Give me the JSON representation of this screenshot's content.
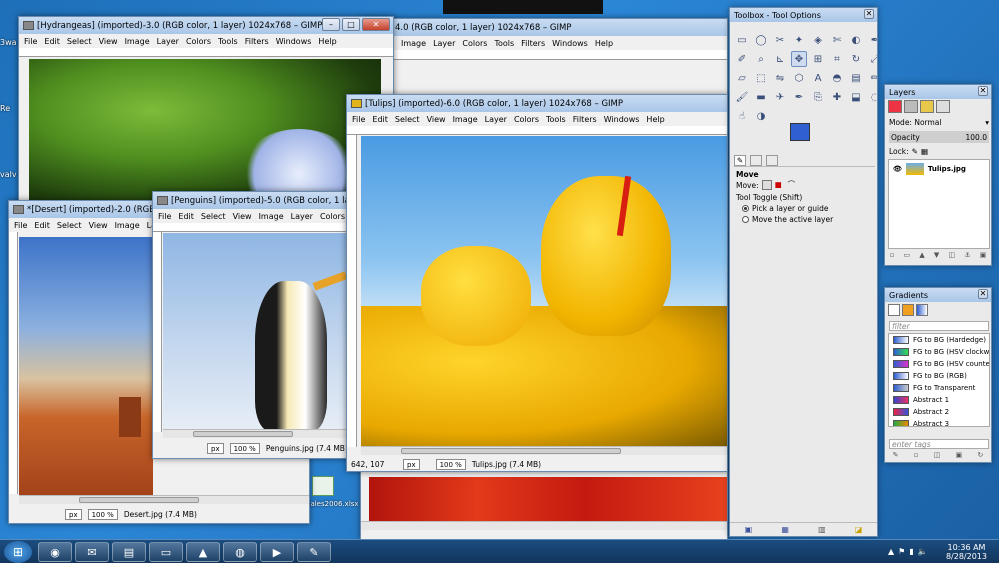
{
  "desktop": {
    "items": [
      {
        "label": "3wa"
      },
      {
        "label": "Re"
      },
      {
        "label": "valv"
      }
    ],
    "file_label": "Sales2006.xlsx"
  },
  "colors": {
    "accent": "#3b6fd6",
    "titlebar": "#b9d1ee",
    "taskbar": "#163f6b"
  },
  "windows": {
    "back": {
      "title": "4.0 (RGB color, 1 layer) 1024x768 – GIMP",
      "menu": [
        "Image",
        "Layer",
        "Colors",
        "Tools",
        "Filters",
        "Windows",
        "Help"
      ]
    },
    "hydrangeas": {
      "title": "[Hydrangeas] (imported)-3.0 (RGB color, 1 layer) 1024x768 – GIMP",
      "menu": [
        "File",
        "Edit",
        "Select",
        "View",
        "Image",
        "Layer",
        "Colors",
        "Tools",
        "Filters",
        "Windows",
        "Help"
      ]
    },
    "desert": {
      "title": "*[Desert] (imported)-2.0 (RGB color",
      "menu": [
        "File",
        "Edit",
        "Select",
        "View",
        "Image",
        "Laye"
      ],
      "unit": "px",
      "zoom": "100 %",
      "status": "Desert.jpg (7.4 MB)"
    },
    "penguins": {
      "title": "[Penguins] (imported)-5.0 (RGB color, 1 layer) 1024x768",
      "menu": [
        "File",
        "Edit",
        "Select",
        "View",
        "Image",
        "Layer",
        "Colors",
        "To"
      ],
      "unit": "px",
      "zoom": "100 %",
      "status": "Penguins.jpg (7.4 MB)"
    },
    "tulips": {
      "title": "[Tulips] (imported)-6.0 (RGB color, 1 layer) 1024x768 – GIMP",
      "menu": [
        "File",
        "Edit",
        "Select",
        "View",
        "Image",
        "Layer",
        "Colors",
        "Tools",
        "Filters",
        "Windows",
        "Help"
      ],
      "coords": "642, 107",
      "unit": "px",
      "zoom": "100 %",
      "status": "Tulips.jpg (7.4 MB)"
    }
  },
  "toolbox": {
    "title": "Toolbox - Tool Options",
    "tools": [
      "rect-select",
      "ellipse-select",
      "free-select",
      "fuzzy-select",
      "color-select",
      "scissors",
      "foreground-select",
      "paths",
      "color-picker",
      "zoom",
      "measure",
      "move",
      "align",
      "crop",
      "rotate",
      "scale",
      "shear",
      "perspective",
      "flip",
      "cage",
      "text",
      "bucket-fill",
      "blend",
      "pencil",
      "paintbrush",
      "eraser",
      "airbrush",
      "ink",
      "clone",
      "heal",
      "perspective-clone",
      "blur",
      "smudge",
      "dodge-burn"
    ],
    "active_tool": "move",
    "option_title": "Move",
    "move_label": "Move:",
    "toggle_label": "Tool Toggle  (Shift)",
    "options": [
      "Pick a layer or guide",
      "Move the active layer"
    ],
    "fg_color": "#2f5fd0",
    "bg_color": "#ffffff"
  },
  "layers": {
    "title": "Layers",
    "mode_label": "Mode: Normal",
    "opacity_label": "Opacity",
    "opacity_value": "100.0",
    "lock_label": "Lock:",
    "layer_name": "Tulips.jpg"
  },
  "gradients": {
    "title": "Gradients",
    "filter_placeholder": "filter",
    "tags_placeholder": "enter tags",
    "items": [
      {
        "name": "FG to BG (Hardedge)",
        "c1": "#2f5fd0",
        "c2": "#ffffff"
      },
      {
        "name": "FG to BG (HSV clockwise",
        "c1": "#2f5fd0",
        "c2": "#33dd55"
      },
      {
        "name": "FG to BG (HSV counter-",
        "c1": "#2f5fd0",
        "c2": "#dd33cc"
      },
      {
        "name": "FG to BG (RGB)",
        "c1": "#2f5fd0",
        "c2": "#ffffff"
      },
      {
        "name": "FG to Transparent",
        "c1": "#2f5fd0",
        "c2": "#cccccc"
      },
      {
        "name": "Abstract 1",
        "c1": "#3344cc",
        "c2": "#ee3366"
      },
      {
        "name": "Abstract 2",
        "c1": "#ee2244",
        "c2": "#3355dd"
      },
      {
        "name": "Abstract 3",
        "c1": "#22aa44",
        "c2": "#ee8800"
      }
    ]
  },
  "taskbar": {
    "apps": [
      {
        "name": "chrome",
        "glyph": "◉"
      },
      {
        "name": "outlook",
        "glyph": "✉"
      },
      {
        "name": "explorer",
        "glyph": "▤"
      },
      {
        "name": "sticky-notes",
        "glyph": "▭"
      },
      {
        "name": "matlab",
        "glyph": "▲"
      },
      {
        "name": "globe",
        "glyph": "◍"
      },
      {
        "name": "media",
        "glyph": "▶"
      },
      {
        "name": "gimp",
        "glyph": "✎"
      }
    ],
    "start_glyph": "⊞",
    "time": "10:36 AM",
    "date": "8/28/2013"
  }
}
